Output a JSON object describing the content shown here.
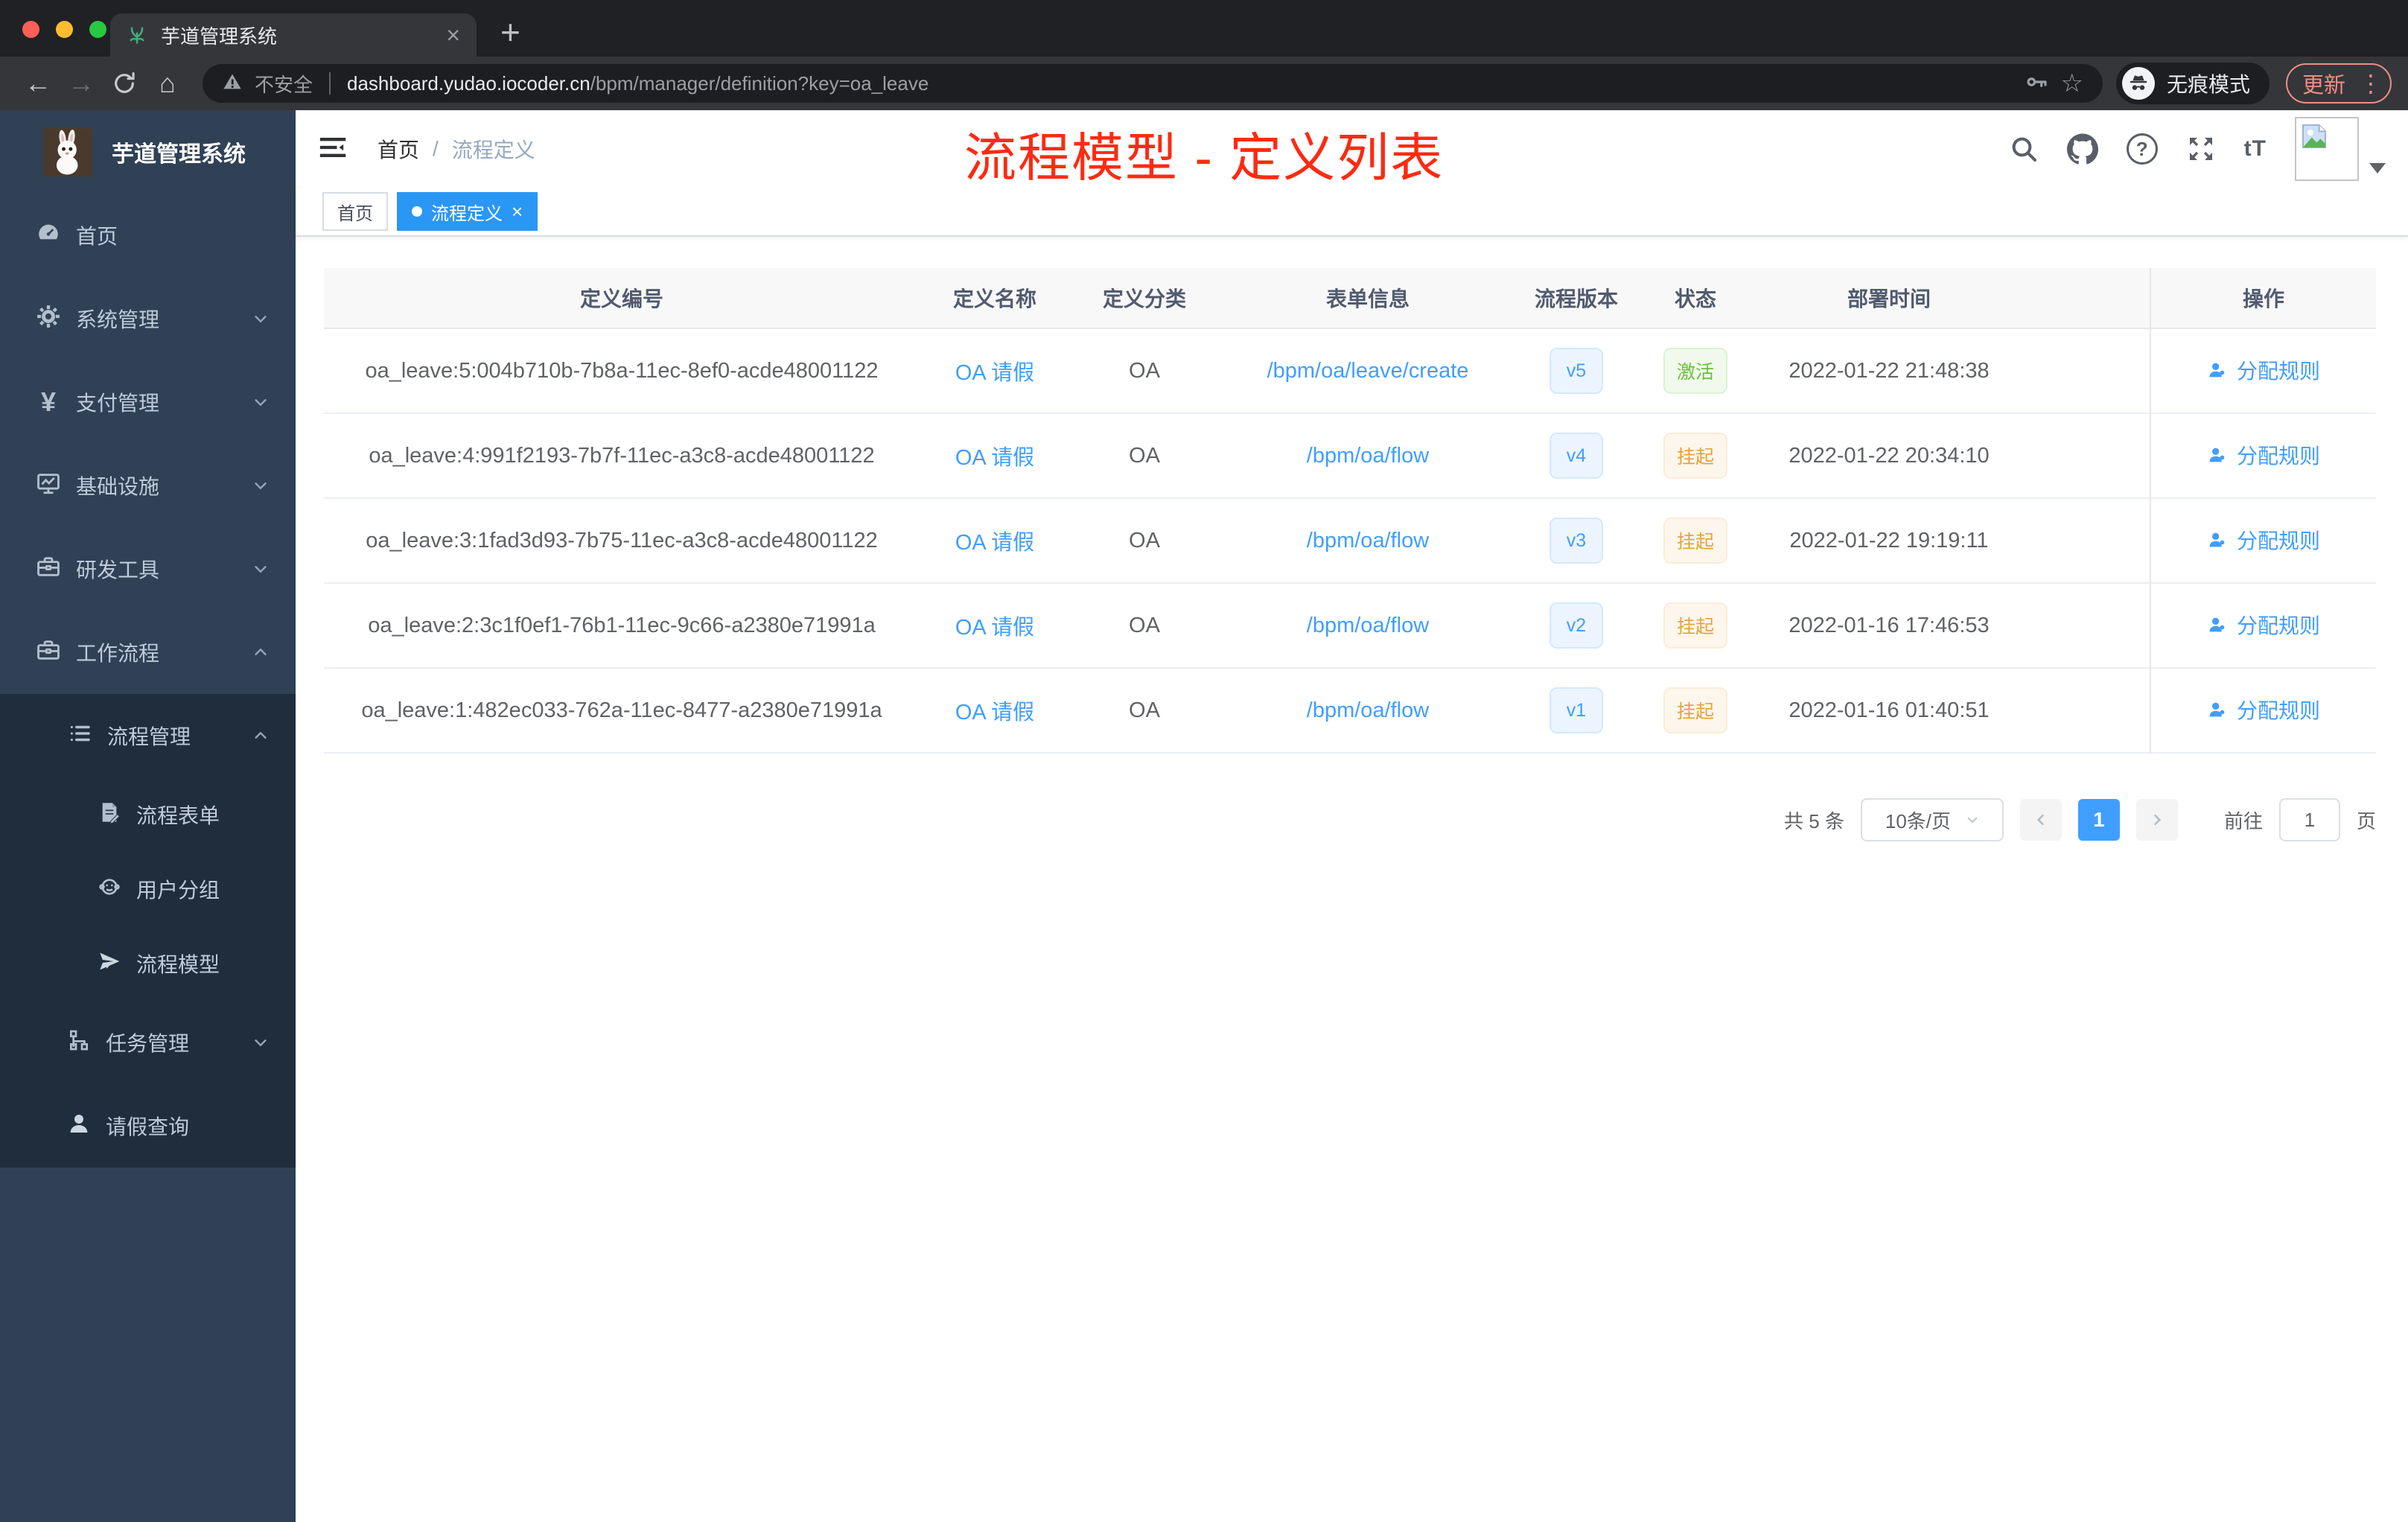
{
  "browser": {
    "tab_title": "芋道管理系统",
    "security_label": "不安全",
    "url_host": "dashboard.yudao.iocoder.cn",
    "url_path": "/bpm/manager/definition?key=oa_leave",
    "incognito_label": "无痕模式",
    "update_label": "更新"
  },
  "sidebar": {
    "logo_title": "芋道管理系统",
    "items": [
      {
        "label": "首页",
        "icon": "dashboard-icon"
      },
      {
        "label": "系统管理",
        "icon": "gear-icon"
      },
      {
        "label": "支付管理",
        "icon": "yen-icon"
      },
      {
        "label": "基础设施",
        "icon": "monitor-icon"
      },
      {
        "label": "研发工具",
        "icon": "toolbox-icon"
      },
      {
        "label": "工作流程",
        "icon": "briefcase-icon",
        "children": [
          {
            "label": "流程管理",
            "icon": "list-icon",
            "children": [
              {
                "label": "流程表单",
                "icon": "form-icon"
              },
              {
                "label": "用户分组",
                "icon": "robot-icon"
              },
              {
                "label": "流程模型",
                "icon": "send-icon"
              }
            ]
          },
          {
            "label": "任务管理",
            "icon": "tree-icon"
          },
          {
            "label": "请假查询",
            "icon": "user-icon"
          }
        ]
      }
    ]
  },
  "header": {
    "breadcrumb_home": "首页",
    "breadcrumb_sep": "/",
    "breadcrumb_current": "流程定义",
    "annotation": "流程模型 - 定义列表"
  },
  "tags": {
    "home": "首页",
    "active": "流程定义"
  },
  "table": {
    "columns": {
      "id": "定义编号",
      "name": "定义名称",
      "category": "定义分类",
      "form": "表单信息",
      "version": "流程版本",
      "status": "状态",
      "deploy_time": "部署时间",
      "action": "操作"
    },
    "rows": [
      {
        "id": "oa_leave:5:004b710b-7b8a-11ec-8ef0-acde48001122",
        "name": "OA 请假",
        "category": "OA",
        "form": "/bpm/oa/leave/create",
        "version": "v5",
        "status": "激活",
        "status_type": "success",
        "deploy_time": "2022-01-22 21:48:38",
        "action": "分配规则"
      },
      {
        "id": "oa_leave:4:991f2193-7b7f-11ec-a3c8-acde48001122",
        "name": "OA 请假",
        "category": "OA",
        "form": "/bpm/oa/flow",
        "version": "v4",
        "status": "挂起",
        "status_type": "warning",
        "deploy_time": "2022-01-22 20:34:10",
        "action": "分配规则"
      },
      {
        "id": "oa_leave:3:1fad3d93-7b75-11ec-a3c8-acde48001122",
        "name": "OA 请假",
        "category": "OA",
        "form": "/bpm/oa/flow",
        "version": "v3",
        "status": "挂起",
        "status_type": "warning",
        "deploy_time": "2022-01-22 19:19:11",
        "action": "分配规则"
      },
      {
        "id": "oa_leave:2:3c1f0ef1-76b1-11ec-9c66-a2380e71991a",
        "name": "OA 请假",
        "category": "OA",
        "form": "/bpm/oa/flow",
        "version": "v2",
        "status": "挂起",
        "status_type": "warning",
        "deploy_time": "2022-01-16 17:46:53",
        "action": "分配规则"
      },
      {
        "id": "oa_leave:1:482ec033-762a-11ec-8477-a2380e71991a",
        "name": "OA 请假",
        "category": "OA",
        "form": "/bpm/oa/flow",
        "version": "v1",
        "status": "挂起",
        "status_type": "warning",
        "deploy_time": "2022-01-16 01:40:51",
        "action": "分配规则"
      }
    ]
  },
  "pagination": {
    "total": "共 5 条",
    "page_size": "10条/页",
    "current_page": "1",
    "goto_label": "前往",
    "goto_value": "1",
    "unit_label": "页"
  }
}
